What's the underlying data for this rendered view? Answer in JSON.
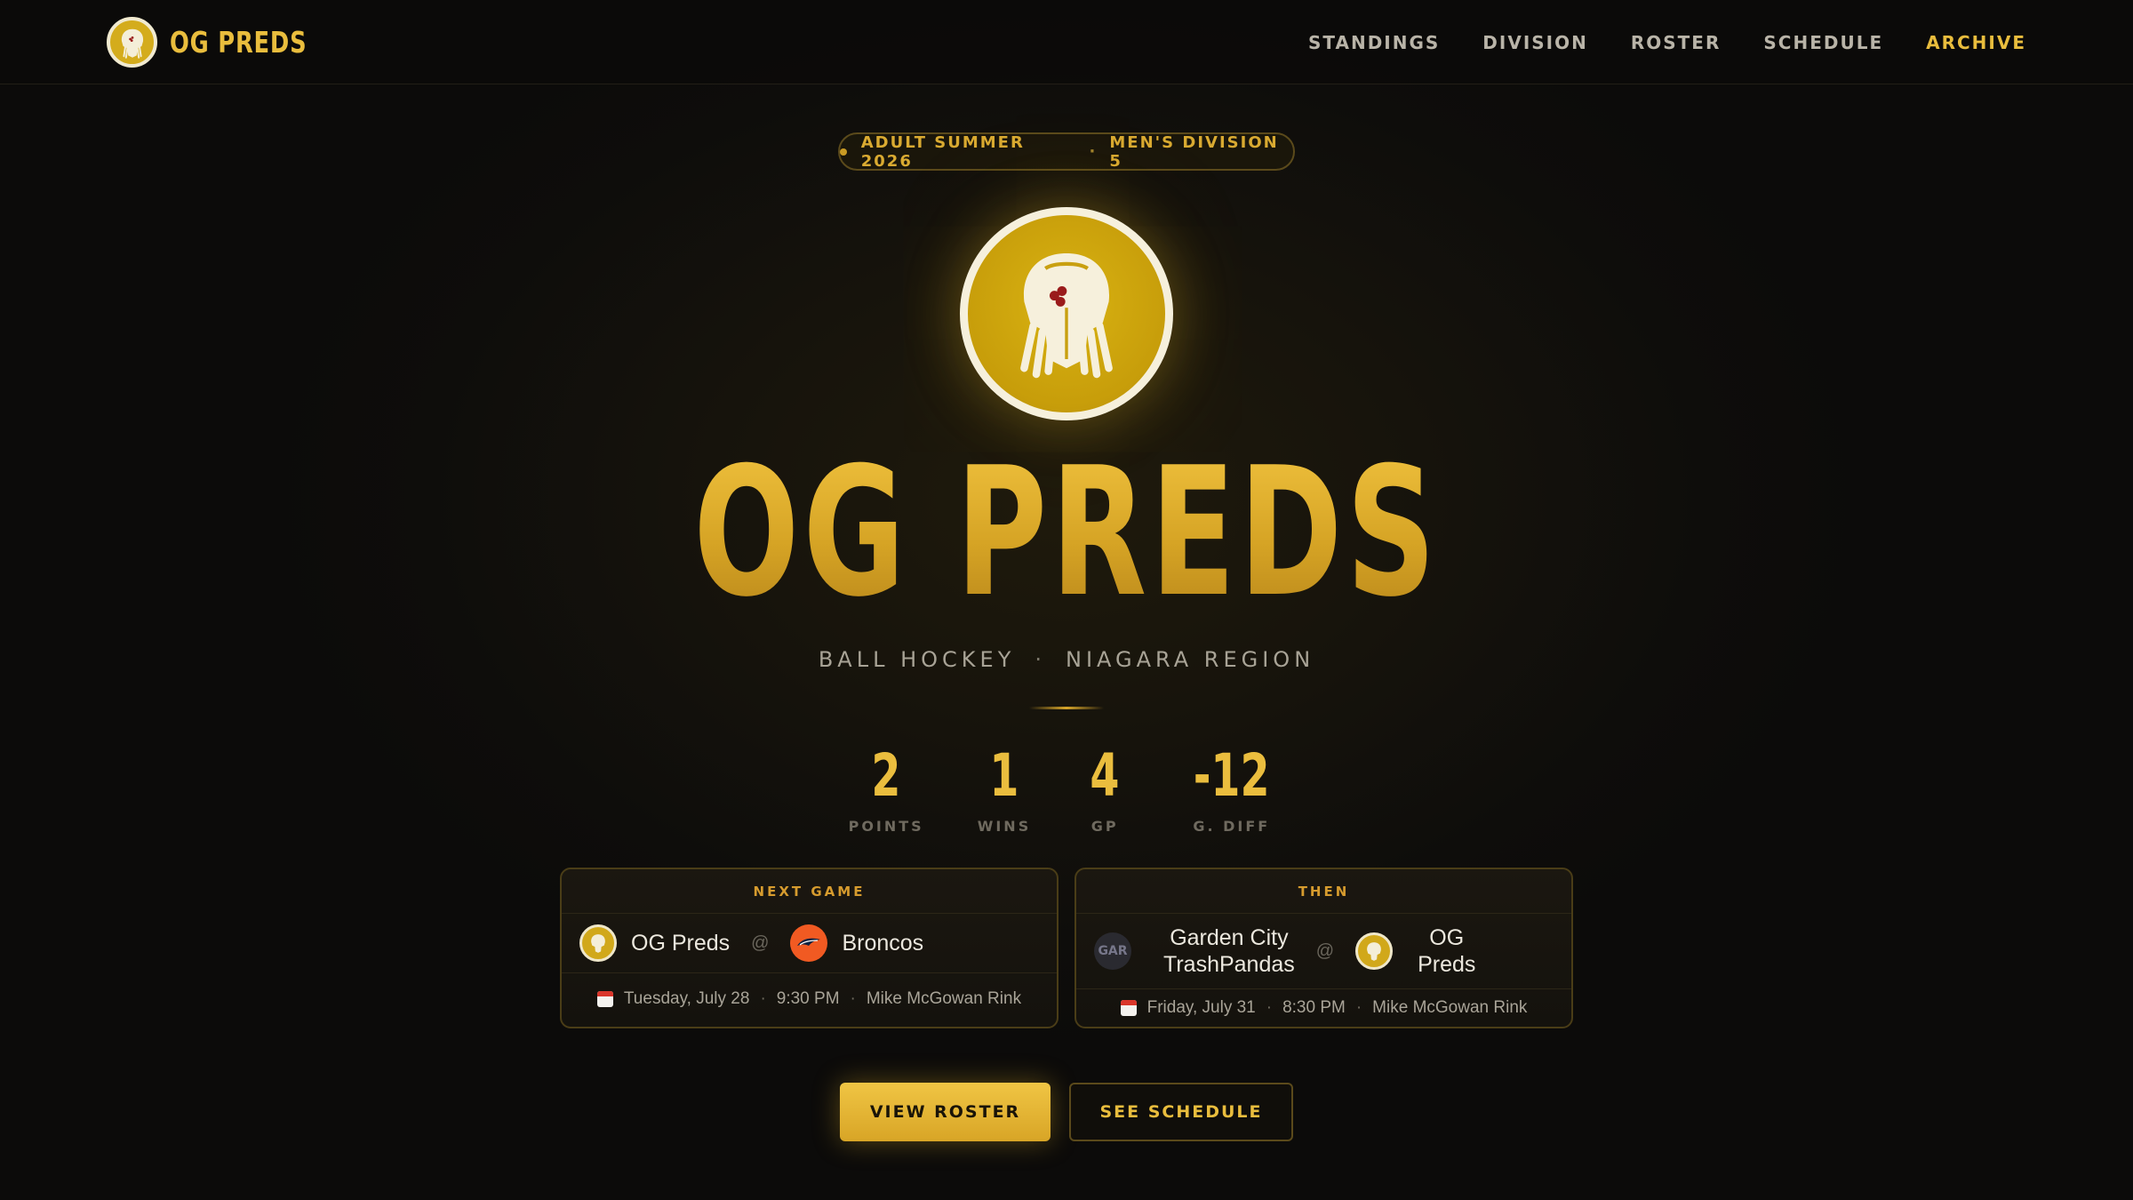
{
  "brand": {
    "name": "OG PREDS",
    "logo_icon": "predator-mask-icon"
  },
  "nav": {
    "items": [
      {
        "label": "STANDINGS",
        "active": false
      },
      {
        "label": "DIVISION",
        "active": false
      },
      {
        "label": "ROSTER",
        "active": false
      },
      {
        "label": "SCHEDULE",
        "active": false
      },
      {
        "label": "ARCHIVE",
        "active": true
      }
    ]
  },
  "hero": {
    "season": "ADULT SUMMER 2026",
    "division": "MEN'S DIVISION 5",
    "separator": "·",
    "title": "OG PREDS",
    "sport": "BALL HOCKEY",
    "region": "NIAGARA REGION"
  },
  "stats": [
    {
      "value": "2",
      "label": "POINTS"
    },
    {
      "value": "1",
      "label": "WINS"
    },
    {
      "value": "4",
      "label": "GP"
    },
    {
      "value": "-12",
      "label": "G. DIFF"
    }
  ],
  "next_game": {
    "heading": "NEXT GAME",
    "home": "OG Preds",
    "away": "Broncos",
    "at": "@",
    "date": "Tuesday, July 28",
    "time": "9:30 PM",
    "venue": "Mike McGowan Rink"
  },
  "then_game": {
    "heading": "THEN",
    "home_line1": "Garden City",
    "home_line2": "TrashPandas",
    "home_abbr": "GAR",
    "away_line1": "OG",
    "away_line2": "Preds",
    "at": "@",
    "date": "Friday, July 31",
    "time": "8:30 PM",
    "venue": "Mike McGowan Rink"
  },
  "buttons": {
    "primary": "VIEW ROSTER",
    "secondary": "SEE SCHEDULE"
  },
  "colors": {
    "accent": "#e9bd3d",
    "background": "#0d0c0a",
    "broncos": "#f15a22"
  }
}
